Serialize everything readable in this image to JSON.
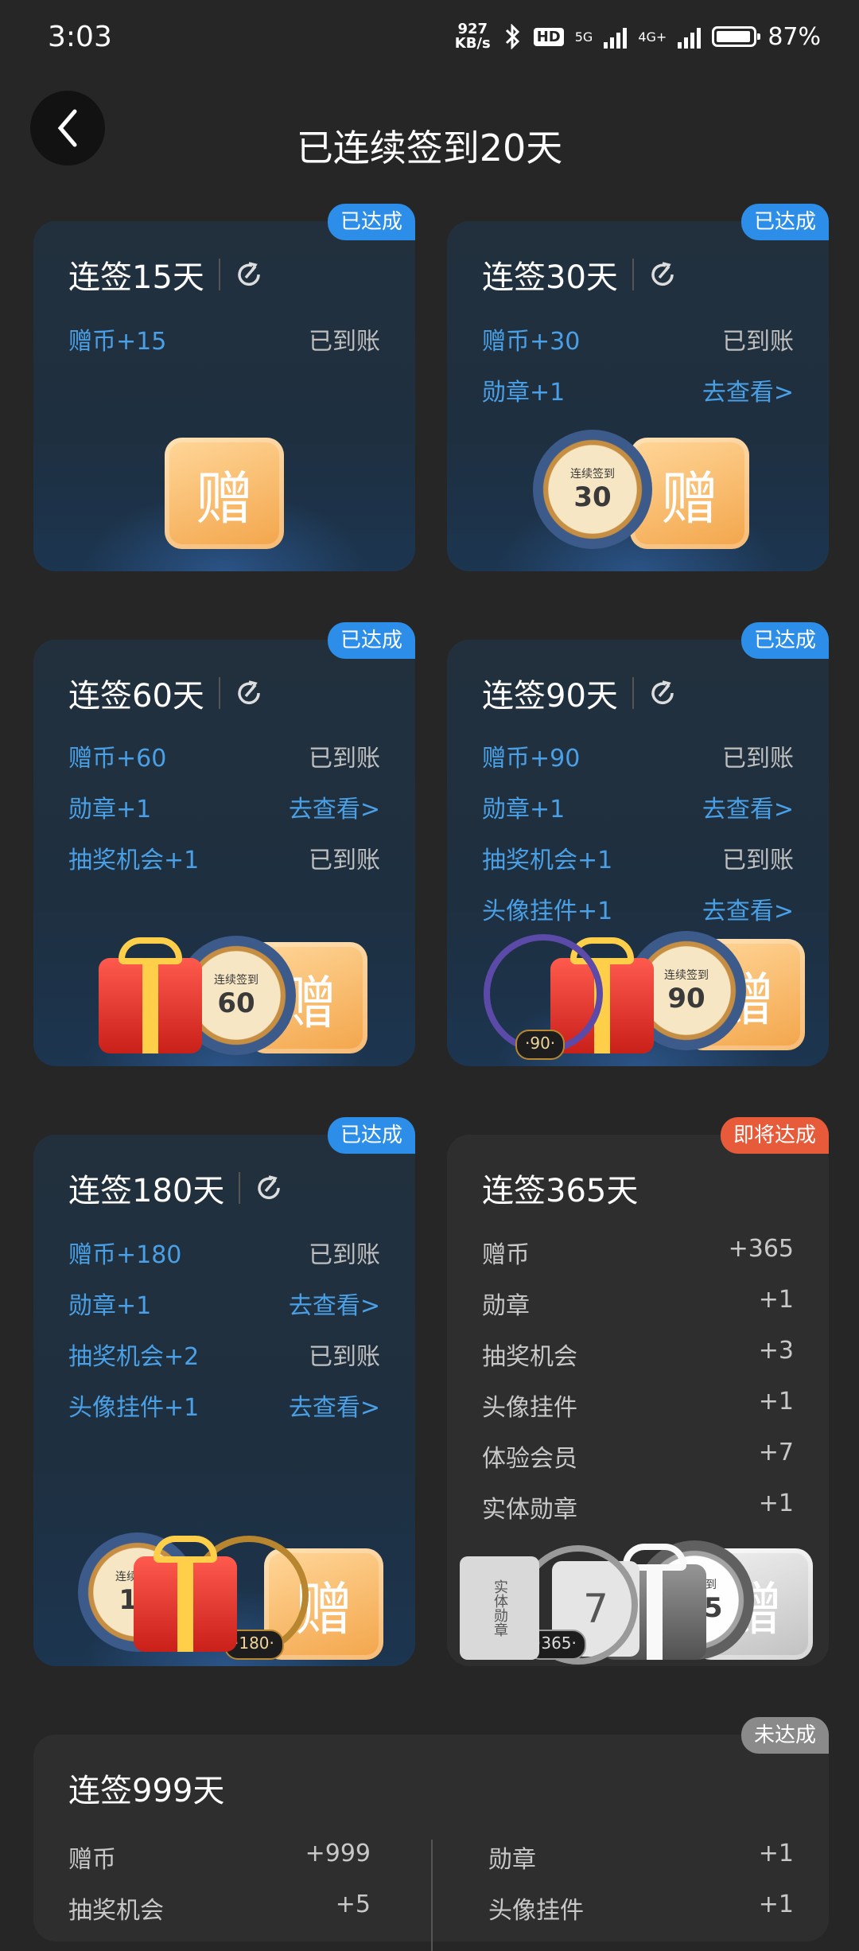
{
  "status": {
    "time": "3:03",
    "net_speed_top": "927",
    "net_speed_bottom": "KB/s",
    "hd": "HD",
    "net1": "5G",
    "net2": "4G+",
    "battery_pct": "87%",
    "battery_level": 0.87
  },
  "header": {
    "title": "已连续签到20天"
  },
  "cards": [
    {
      "title": "连签15天",
      "badge": "已达成",
      "rows": [
        {
          "label": "赠币+15",
          "value": "已到账"
        }
      ]
    },
    {
      "title": "连签30天",
      "badge": "已达成",
      "rows": [
        {
          "label": "赠币+30",
          "value": "已到账"
        },
        {
          "label": "勋章+1",
          "value": "去查看>"
        }
      ]
    },
    {
      "title": "连签60天",
      "badge": "已达成",
      "rows": [
        {
          "label": "赠币+60",
          "value": "已到账"
        },
        {
          "label": "勋章+1",
          "value": "去查看>"
        },
        {
          "label": "抽奖机会+1",
          "value": "已到账"
        }
      ]
    },
    {
      "title": "连签90天",
      "badge": "已达成",
      "rows": [
        {
          "label": "赠币+90",
          "value": "已到账"
        },
        {
          "label": "勋章+1",
          "value": "去查看>"
        },
        {
          "label": "抽奖机会+1",
          "value": "已到账"
        },
        {
          "label": "头像挂件+1",
          "value": "去查看>"
        }
      ]
    },
    {
      "title": "连签180天",
      "badge": "已达成",
      "rows": [
        {
          "label": "赠币+180",
          "value": "已到账"
        },
        {
          "label": "勋章+1",
          "value": "去查看>"
        },
        {
          "label": "抽奖机会+2",
          "value": "已到账"
        },
        {
          "label": "头像挂件+1",
          "value": "去查看>"
        }
      ]
    },
    {
      "title": "连签365天",
      "badge": "即将达成",
      "rows": [
        {
          "label": "赠币",
          "value": "+365"
        },
        {
          "label": "勋章",
          "value": "+1"
        },
        {
          "label": "抽奖机会",
          "value": "+3"
        },
        {
          "label": "头像挂件",
          "value": "+1"
        },
        {
          "label": "体验会员",
          "value": "+7"
        },
        {
          "label": "实体勋章",
          "value": "+1"
        }
      ]
    },
    {
      "title": "连签999天",
      "badge": "未达成",
      "left_rows": [
        {
          "label": "赠币",
          "value": "+999"
        },
        {
          "label": "抽奖机会",
          "value": "+5"
        }
      ],
      "right_rows": [
        {
          "label": "勋章",
          "value": "+1"
        },
        {
          "label": "头像挂件",
          "value": "+1"
        }
      ]
    }
  ],
  "art": {
    "ticket_char": "赠",
    "medal_text": "连续签到",
    "medal30": "30",
    "medal60": "60",
    "medal90": "90",
    "medal180": "18",
    "medal365": "365",
    "plate90": "·90·",
    "plate180": "·180·",
    "plate365": "·365·",
    "book_text": "实体勋章",
    "coupon_num": "7"
  }
}
